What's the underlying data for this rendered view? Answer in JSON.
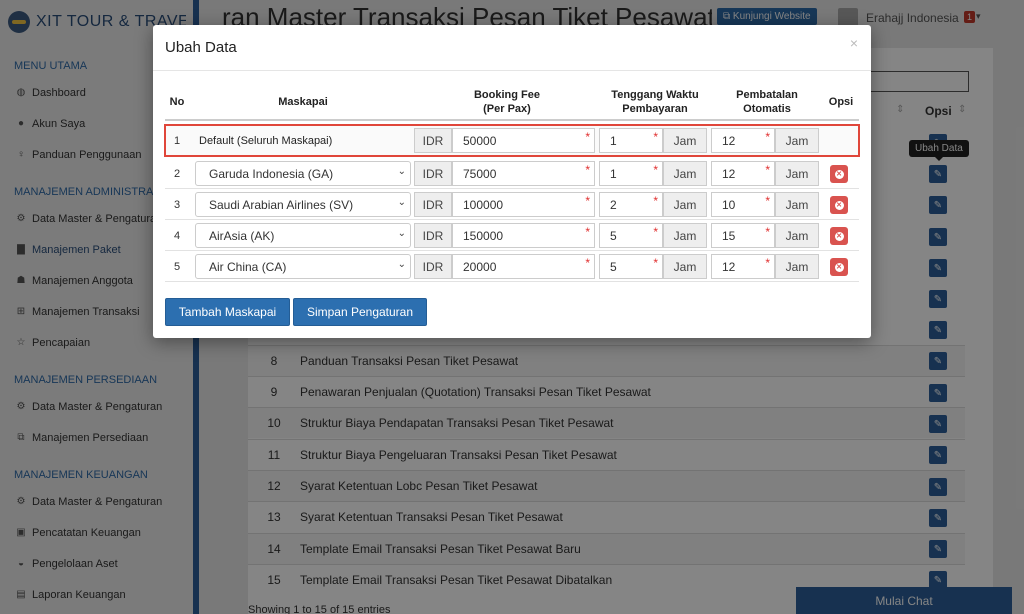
{
  "app": {
    "brand": "XIT TOUR & TRAVEL",
    "page_title": "ran Master Transaksi Pesan Tiket Pesawat",
    "visit_button": "Kunjungi Website",
    "user_name": "Erahajj Indonesia",
    "user_badge": "1"
  },
  "sidebar": {
    "sections": [
      {
        "title": "MENU UTAMA",
        "items": [
          "Dashboard",
          "Akun Saya",
          "Panduan Penggunaan"
        ]
      },
      {
        "title": "MANAJEMEN ADMINISTRASI",
        "items": [
          "Data Master & Pengaturan",
          "Manajemen Paket",
          "Manajemen Anggota",
          "Manajemen Transaksi",
          "Pencapaian"
        ]
      },
      {
        "title": "MANAJEMEN PERSEDIAAN",
        "items": [
          "Data Master & Pengaturan",
          "Manajemen Persediaan"
        ]
      },
      {
        "title": "MANAJEMEN KEUANGAN",
        "items": [
          "Data Master & Pengaturan",
          "Pencatatan Keuangan",
          "Pengelolaan Aset",
          "Laporan Keuangan"
        ]
      }
    ]
  },
  "background_table": {
    "opsi_header": "Opsi",
    "tooltip": "Ubah Data",
    "rows": [
      {
        "no": "8",
        "name": "Panduan Transaksi Pesan Tiket Pesawat"
      },
      {
        "no": "9",
        "name": "Penawaran Penjualan (Quotation) Transaksi Pesan Tiket Pesawat"
      },
      {
        "no": "10",
        "name": "Struktur Biaya Pendapatan Transaksi Pesan Tiket Pesawat"
      },
      {
        "no": "11",
        "name": "Struktur Biaya Pengeluaran Transaksi Pesan Tiket Pesawat"
      },
      {
        "no": "12",
        "name": "Syarat Ketentuan Lobc Pesan Tiket Pesawat"
      },
      {
        "no": "13",
        "name": "Syarat Ketentuan Transaksi Pesan Tiket Pesawat"
      },
      {
        "no": "14",
        "name": "Template Email Transaksi Pesan Tiket Pesawat Baru"
      },
      {
        "no": "15",
        "name": "Template Email Transaksi Pesan Tiket Pesawat Dibatalkan"
      }
    ],
    "showing": "Showing 1 to 15 of 15 entries"
  },
  "chat_button": "Mulai Chat",
  "modal": {
    "title": "Ubah Data",
    "close": "×",
    "headers": {
      "no": "No",
      "airline": "Maskapai",
      "fee_line1": "Booking Fee",
      "fee_line2": "(Per Pax)",
      "pay_line1": "Tenggang Waktu",
      "pay_line2": "Pembayaran",
      "cancel_line1": "Pembatalan",
      "cancel_line2": "Otomatis",
      "options": "Opsi"
    },
    "currency": "IDR",
    "unit": "Jam",
    "rows": [
      {
        "no": "1",
        "airline": "Default (Seluruh Maskapai)",
        "fee": "50000",
        "pay": "1",
        "cancel": "12"
      },
      {
        "no": "2",
        "airline": "Garuda Indonesia (GA)",
        "fee": "75000",
        "pay": "1",
        "cancel": "12"
      },
      {
        "no": "3",
        "airline": "Saudi Arabian Airlines (SV)",
        "fee": "100000",
        "pay": "2",
        "cancel": "10"
      },
      {
        "no": "4",
        "airline": "AirAsia (AK)",
        "fee": "150000",
        "pay": "5",
        "cancel": "15"
      },
      {
        "no": "5",
        "airline": "Air China (CA)",
        "fee": "20000",
        "pay": "5",
        "cancel": "12"
      }
    ],
    "add_button": "Tambah Maskapai",
    "save_button": "Simpan Pengaturan"
  }
}
